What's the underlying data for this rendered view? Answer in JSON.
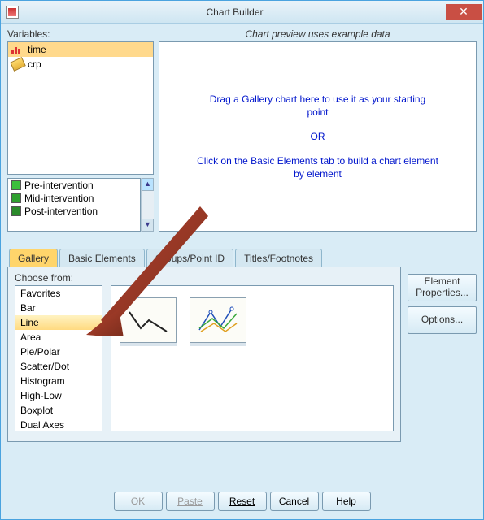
{
  "window": {
    "title": "Chart Builder",
    "close_glyph": "✕"
  },
  "variables": {
    "label": "Variables:",
    "items": [
      {
        "name": "time",
        "icon": "bar",
        "selected": true
      },
      {
        "name": "crp",
        "icon": "ruler",
        "selected": false
      }
    ],
    "categories": [
      {
        "label": "Pre-intervention",
        "color": "sw-g1"
      },
      {
        "label": "Mid-intervention",
        "color": "sw-g2"
      },
      {
        "label": "Post-intervention",
        "color": "sw-g3"
      }
    ],
    "scroll_up": "▲",
    "scroll_down": "▼"
  },
  "preview": {
    "caption": "Chart preview uses example data",
    "line1": "Drag a Gallery chart here to use it as your starting point",
    "or": "OR",
    "line2": "Click on the Basic Elements tab to build a chart element by element"
  },
  "tabs": {
    "gallery": "Gallery",
    "basic": "Basic Elements",
    "groups": "Groups/Point ID",
    "titles": "Titles/Footnotes"
  },
  "gallery": {
    "choose_label": "Choose from:",
    "types": [
      "Favorites",
      "Bar",
      "Line",
      "Area",
      "Pie/Polar",
      "Scatter/Dot",
      "Histogram",
      "High-Low",
      "Boxplot",
      "Dual Axes"
    ],
    "selected": "Line"
  },
  "side": {
    "element_props": "Element Properties...",
    "options": "Options..."
  },
  "buttons": {
    "ok": "OK",
    "paste": "Paste",
    "reset": "Reset",
    "cancel": "Cancel",
    "help": "Help"
  }
}
